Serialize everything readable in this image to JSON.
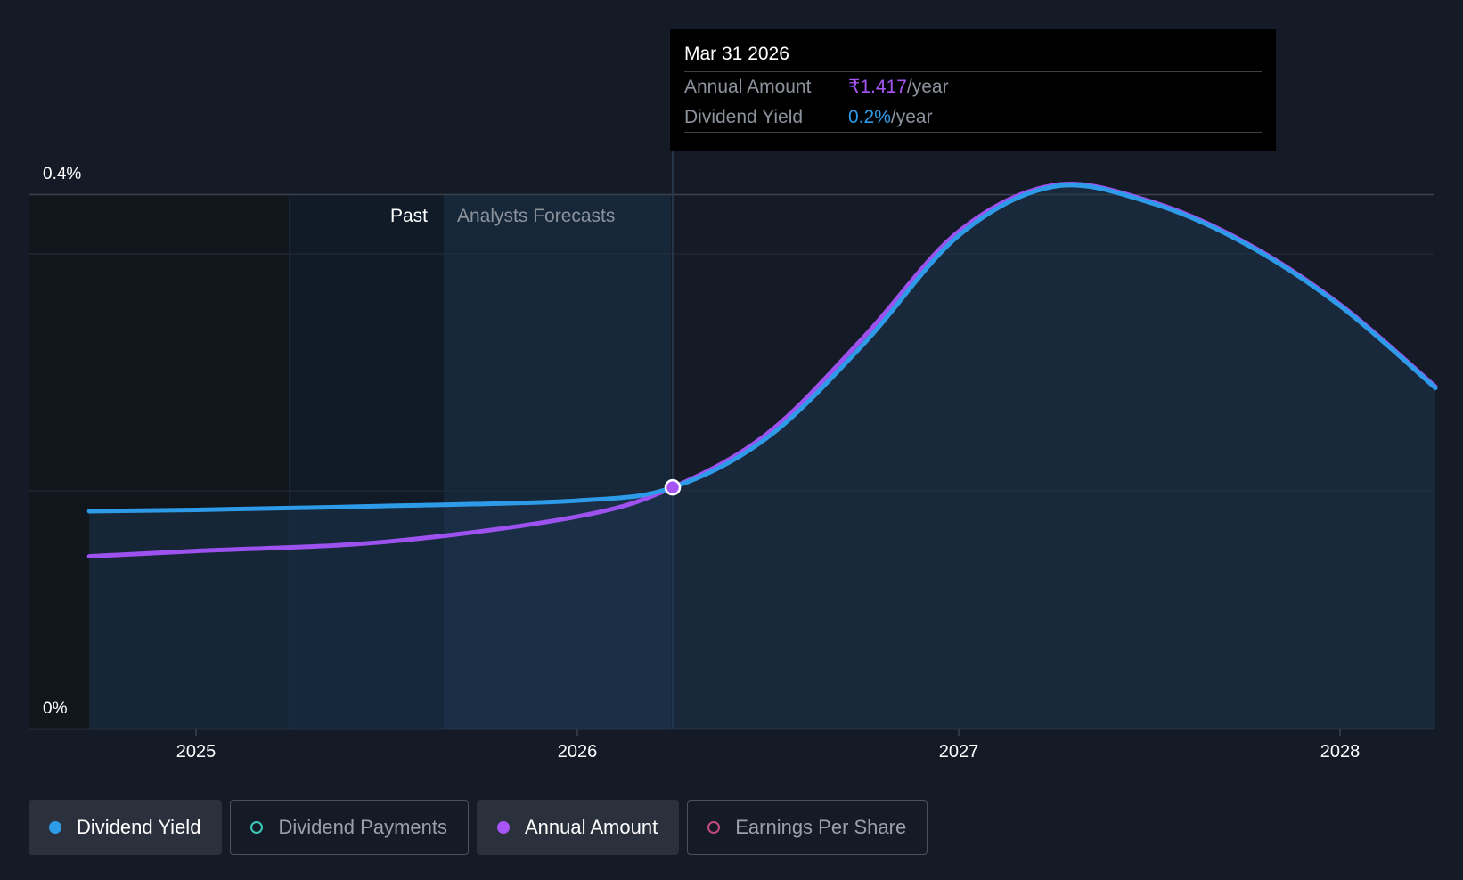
{
  "chart_data": {
    "type": "line",
    "y_axis": {
      "ticks": [
        "0.4%",
        "0%"
      ],
      "ylim": [
        0,
        0.45
      ]
    },
    "x_axis": {
      "ticks": [
        "2025",
        "2026",
        "2027",
        "2028"
      ]
    },
    "regions": {
      "past_label": "Past",
      "forecast_label": "Analysts Forecasts"
    },
    "series": [
      {
        "name": "Dividend Yield",
        "color": "#2e9be8",
        "x": [
          2024.72,
          2025.0,
          2025.5,
          2026.0,
          2026.25,
          2026.5,
          2026.75,
          2027.0,
          2027.25,
          2027.5,
          2027.75,
          2028.0,
          2028.25
        ],
        "y": [
          0.164,
          0.165,
          0.168,
          0.172,
          0.182,
          0.22,
          0.29,
          0.372,
          0.409,
          0.397,
          0.366,
          0.319,
          0.257
        ]
      },
      {
        "name": "Annual Amount",
        "color": "#9d52f0",
        "x": [
          2024.72,
          2025.0,
          2025.5,
          2026.0,
          2026.25,
          2026.5,
          2026.75,
          2027.0,
          2027.25,
          2027.5,
          2027.75,
          2028.0,
          2028.25
        ],
        "y": [
          0.13,
          0.134,
          0.141,
          0.16,
          0.182,
          0.223,
          0.295,
          0.375,
          0.41,
          0.398,
          0.367,
          0.32,
          0.258
        ]
      }
    ],
    "highlight": {
      "x": 2026.25
    }
  },
  "tooltip": {
    "date": "Mar 31 2026",
    "rows": [
      {
        "label": "Annual Amount",
        "value": "₹1.417",
        "unit": "/year",
        "color": "#a855f7"
      },
      {
        "label": "Dividend Yield",
        "value": "0.2%",
        "unit": "/year",
        "color": "#2e9be8"
      }
    ]
  },
  "legend": [
    {
      "label": "Dividend Yield",
      "color": "#2e9be8",
      "active": true
    },
    {
      "label": "Dividend Payments",
      "color": "#3ec8b8",
      "active": false
    },
    {
      "label": "Annual Amount",
      "color": "#a855f7",
      "active": true
    },
    {
      "label": "Earnings Per Share",
      "color": "#c24a7f",
      "active": false
    }
  ]
}
